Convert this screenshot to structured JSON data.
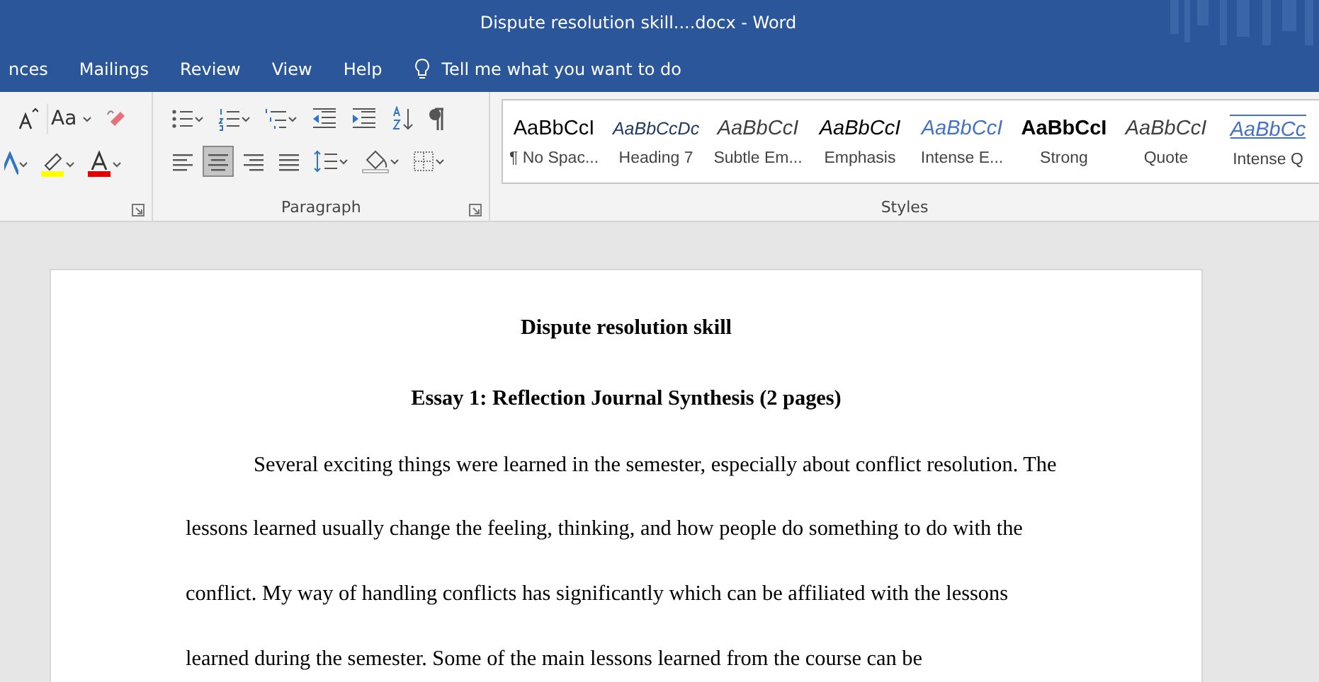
{
  "window": {
    "title": "Dispute resolution skill....docx  -  Word"
  },
  "menu_tabs": [
    "nces",
    "Mailings",
    "Review",
    "View",
    "Help"
  ],
  "tell_me": "Tell me what you want to do",
  "ribbon": {
    "font_group": {
      "change_case": "Aa"
    },
    "paragraph_group": {
      "label": "Paragraph",
      "alignment_buttons": [
        {
          "kind": "left",
          "selected": false
        },
        {
          "kind": "center",
          "selected": true
        },
        {
          "kind": "right",
          "selected": false
        },
        {
          "kind": "justify",
          "selected": false
        }
      ]
    },
    "styles_group": {
      "label": "Styles",
      "items": [
        {
          "kind": "normal",
          "preview": "AaBbCcI",
          "label": "¶ No Spac..."
        },
        {
          "kind": "heading",
          "preview": "AaBbCcDc",
          "label": "Heading 7"
        },
        {
          "kind": "subtle",
          "preview": "AaBbCcI",
          "label": "Subtle Em..."
        },
        {
          "kind": "emphasis",
          "preview": "AaBbCcI",
          "label": "Emphasis"
        },
        {
          "kind": "intense",
          "preview": "AaBbCcI",
          "label": "Intense E..."
        },
        {
          "kind": "strong",
          "preview": "AaBbCcI",
          "label": "Strong"
        },
        {
          "kind": "quote",
          "preview": "AaBbCcI",
          "label": "Quote"
        },
        {
          "kind": "intense-quote",
          "preview": "AaBbCc",
          "label": "Intense Q"
        }
      ]
    }
  },
  "document": {
    "title": "Dispute resolution skill",
    "subtitle": "Essay 1: Reflection Journal Synthesis (2 pages)",
    "paragraph": "Several exciting things were learned in the semester, especially about conflict resolution. The lessons learned usually change the feeling, thinking, and how people do something to do with the conflict. My way of handling conflicts has significantly which can be affiliated with the lessons learned during the semester. Some of the main lessons learned from the course can be"
  }
}
